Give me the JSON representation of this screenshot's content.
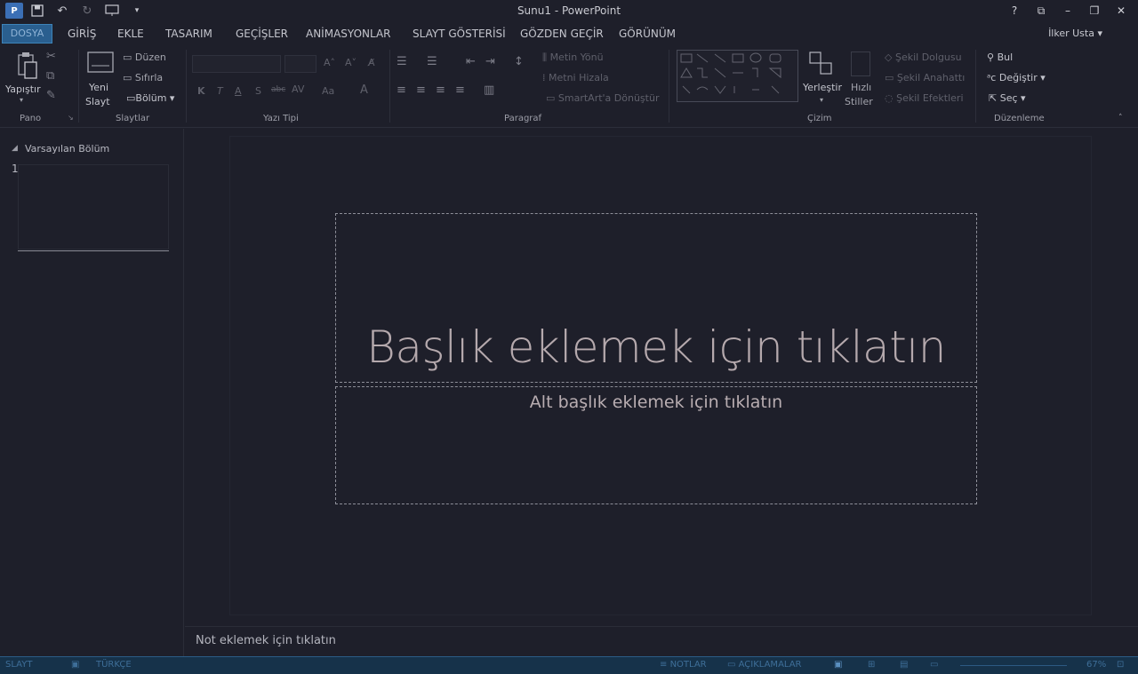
{
  "window": {
    "title": "Sunu1 - PowerPoint",
    "controls": [
      "?",
      "⧉",
      "–",
      "❐",
      "✕"
    ]
  },
  "qat": {
    "undo": "↶",
    "redo": "↻",
    "more": "▾"
  },
  "tabs": {
    "file": "DOSYA",
    "items": [
      "GİRİŞ",
      "EKLE",
      "TASARIM",
      "GEÇİŞLER",
      "ANİMASYONLAR",
      "SLAYT GÖSTERİSİ",
      "GÖZDEN GEÇİR",
      "GÖRÜNÜM"
    ]
  },
  "user": "İlker Usta",
  "ribbon": {
    "pano": {
      "label": "Pano",
      "paste": "Yapıştır"
    },
    "slaytlar": {
      "label": "Slaytlar",
      "new_slide_1": "Yeni",
      "new_slide_2": "Slayt",
      "layout": "Düzen",
      "reset": "Sıfırla",
      "section": "Bölüm"
    },
    "yazi_tipi": {
      "label": "Yazı Tipi"
    },
    "paragraf": {
      "label": "Paragraf",
      "text_direction": "Metin Yönü",
      "align_text": "Metni Hizala",
      "smartart": "SmartArt'a Dönüştür"
    },
    "cizim": {
      "label": "Çizim",
      "arrange": "Yerleştir",
      "quick_styles_1": "Hızlı",
      "quick_styles_2": "Stiller",
      "shape_fill": "Şekil Dolgusu",
      "shape_outline": "Şekil Anahattı",
      "shape_effects": "Şekil Efektleri"
    },
    "duzenleme": {
      "label": "Düzenleme",
      "find": "Bul",
      "replace": "Değiştir",
      "select": "Seç"
    }
  },
  "leftpane": {
    "section": "Varsayılan Bölüm",
    "slide_number": "1"
  },
  "slide": {
    "title_placeholder": "Başlık eklemek için tıklatın",
    "subtitle_placeholder": "Alt başlık eklemek için tıklatın"
  },
  "notes": {
    "placeholder": "Not eklemek için tıklatın"
  },
  "status": {
    "slide": "SLAYT",
    "language": "TÜRKÇE",
    "notes": "NOTLAR",
    "comments": "AÇIKLAMALAR",
    "zoom": "67%"
  }
}
